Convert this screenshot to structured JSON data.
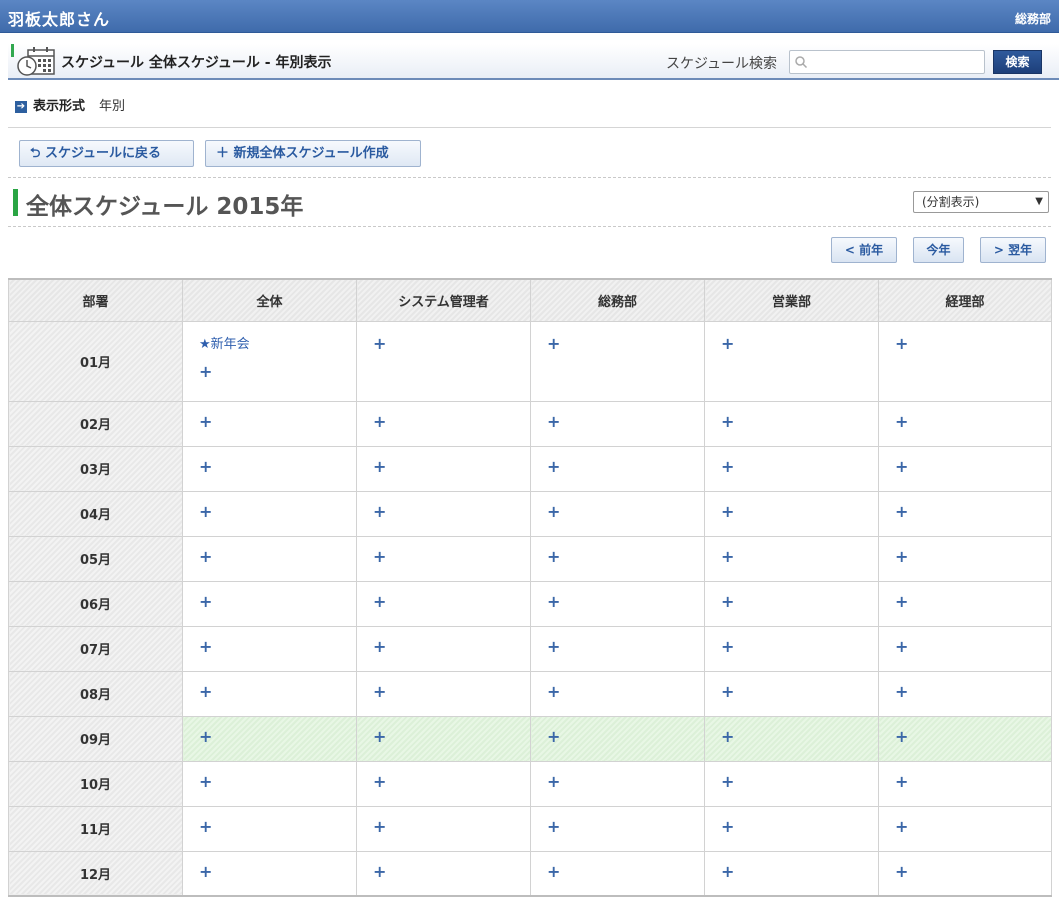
{
  "header": {
    "user": "羽板太郎さん",
    "dept": "総務部"
  },
  "titlebar": {
    "title": "スケジュール 全体スケジュール - 年別表示",
    "search_label": "スケジュール検索",
    "search_value": "",
    "search_button": "検索"
  },
  "display": {
    "label": "表示形式",
    "value": "年別"
  },
  "actions": {
    "back": "スケジュールに戻る",
    "new": "新規全体スケジュール作成"
  },
  "heading": "全体スケジュール 2015年",
  "view_select": "(分割表示)",
  "nav": {
    "prev": "< 前年",
    "today": "今年",
    "next": "> 翌年"
  },
  "columns": [
    "部署",
    "全体",
    "システム管理者",
    "総務部",
    "営業部",
    "経理部"
  ],
  "rows": [
    {
      "month": "01月",
      "events": [
        [
          "★新年会"
        ],
        [],
        [],
        [],
        []
      ]
    },
    {
      "month": "02月",
      "events": [
        [],
        [],
        [],
        [],
        []
      ]
    },
    {
      "month": "03月",
      "events": [
        [],
        [],
        [],
        [],
        []
      ]
    },
    {
      "month": "04月",
      "events": [
        [],
        [],
        [],
        [],
        []
      ]
    },
    {
      "month": "05月",
      "events": [
        [],
        [],
        [],
        [],
        []
      ]
    },
    {
      "month": "06月",
      "events": [
        [],
        [],
        [],
        [],
        []
      ]
    },
    {
      "month": "07月",
      "events": [
        [],
        [],
        [],
        [],
        []
      ]
    },
    {
      "month": "08月",
      "events": [
        [],
        [],
        [],
        [],
        []
      ]
    },
    {
      "month": "09月",
      "current": true,
      "events": [
        [],
        [],
        [],
        [],
        []
      ]
    },
    {
      "month": "10月",
      "events": [
        [],
        [],
        [],
        [],
        []
      ]
    },
    {
      "month": "11月",
      "events": [
        [],
        [],
        [],
        [],
        []
      ]
    },
    {
      "month": "12月",
      "events": [
        [],
        [],
        [],
        [],
        []
      ]
    }
  ],
  "add_symbol": "+",
  "colors": {
    "topbar": "#4a76b8",
    "accent_green": "#2aa544",
    "link": "#2f5fae",
    "current_row": "#e3f5df"
  }
}
